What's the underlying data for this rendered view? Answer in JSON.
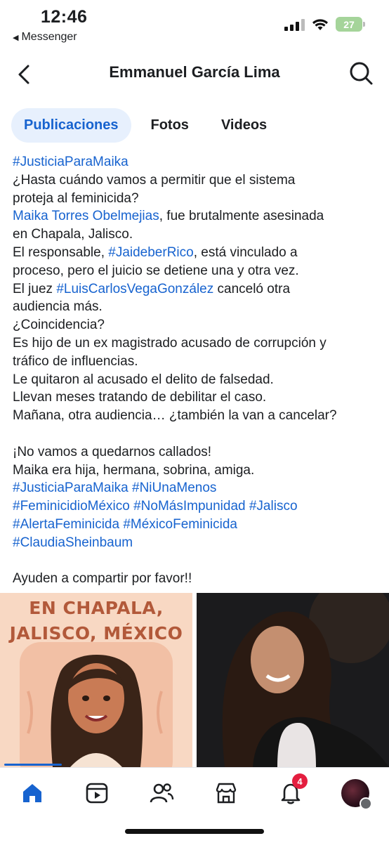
{
  "status_bar": {
    "time": "12:46",
    "back_app": "Messenger",
    "battery": "27"
  },
  "header": {
    "title": "Emmanuel García Lima"
  },
  "tabs": [
    {
      "label": "Publicaciones",
      "active": true
    },
    {
      "label": "Fotos",
      "active": false
    },
    {
      "label": "Videos",
      "active": false
    }
  ],
  "post": {
    "lines": [
      [
        {
          "t": "#JusticiaParaMaika",
          "link": true
        }
      ],
      [
        {
          "t": "¿Hasta cuándo vamos a permitir que el sistema"
        }
      ],
      [
        {
          "t": "proteja al feminicida?"
        }
      ],
      [
        {
          "t": "Maika Torres Obelmejias",
          "link": true
        },
        {
          "t": ", fue brutalmente asesinada"
        }
      ],
      [
        {
          "t": "en Chapala, Jalisco."
        }
      ],
      [
        {
          "t": "El responsable, "
        },
        {
          "t": "#JaideberRico",
          "link": true
        },
        {
          "t": ", está vinculado a"
        }
      ],
      [
        {
          "t": "proceso, pero el juicio se detiene una y otra vez."
        }
      ],
      [
        {
          "t": "El juez "
        },
        {
          "t": "#LuisCarlosVegaGonzález",
          "link": true
        },
        {
          "t": " canceló otra"
        }
      ],
      [
        {
          "t": "audiencia más."
        }
      ],
      [
        {
          "t": "¿Coincidencia?"
        }
      ],
      [
        {
          "t": "Es hijo de un ex magistrado acusado de corrupción y"
        }
      ],
      [
        {
          "t": "tráfico de influencias."
        }
      ],
      [
        {
          "t": "Le quitaron al acusado el delito de falsedad."
        }
      ],
      [
        {
          "t": "Llevan meses tratando de debilitar el caso."
        }
      ],
      [
        {
          "t": "Mañana, otra audiencia… ¿también la van a cancelar?"
        }
      ],
      [],
      [
        {
          "t": "¡No vamos a quedarnos callados!"
        }
      ],
      [
        {
          "t": "Maika era hija, hermana, sobrina, amiga."
        }
      ],
      [
        {
          "t": "#JusticiaParaMaika #NiUnaMenos",
          "link": true
        }
      ],
      [
        {
          "t": "#FeminicidioMéxico #NoMásImpunidad #Jalisco",
          "link": true
        }
      ],
      [
        {
          "t": "#AlertaFeminicida #MéxicoFeminicida",
          "link": true
        }
      ],
      [
        {
          "t": "#ClaudiaSheinbaum",
          "link": true
        }
      ],
      [],
      [
        {
          "t": "Ayuden a compartir por favor!!"
        }
      ]
    ]
  },
  "images": {
    "left_poster_text_line1": "EN CHAPALA,",
    "left_poster_text_line2": "JALISCO, MÉXICO"
  },
  "bottom_nav": {
    "items": [
      {
        "name": "home-icon",
        "active": true
      },
      {
        "name": "video-icon",
        "active": false
      },
      {
        "name": "friends-icon",
        "active": false
      },
      {
        "name": "marketplace-icon",
        "active": false
      },
      {
        "name": "notifications-icon",
        "active": false,
        "badge": "4"
      },
      {
        "name": "profile-avatar",
        "active": false
      }
    ]
  },
  "colors": {
    "link": "#1763cf",
    "active_tab_bg": "#e7f0fd",
    "badge": "#e41e3f"
  }
}
